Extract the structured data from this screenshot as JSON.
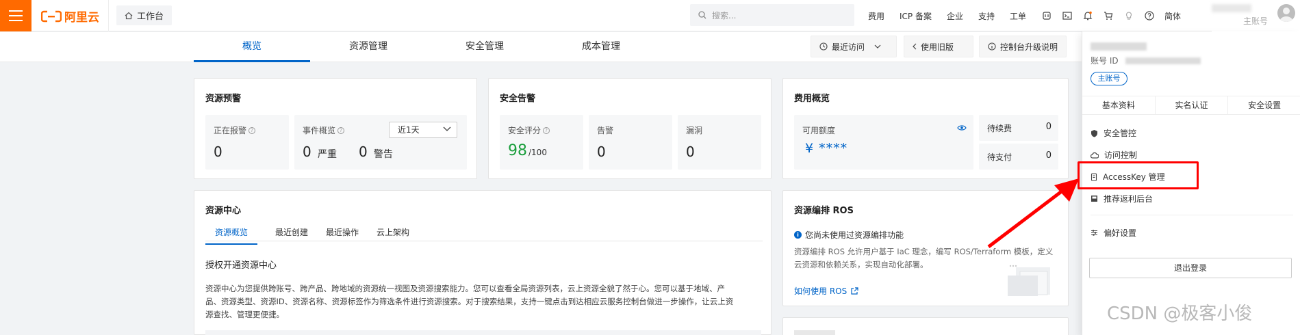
{
  "topbar": {
    "logo_text": "阿里云",
    "workbench_label": "工作台",
    "search_placeholder": "搜索...",
    "links": [
      "费用",
      "ICP 备案",
      "企业",
      "支持",
      "工单"
    ],
    "lang": "简体",
    "account_label": "主账号"
  },
  "nav": {
    "tabs": [
      "概览",
      "资源管理",
      "安全管理",
      "成本管理"
    ],
    "recent": "最近访问",
    "old_version": "使用旧版",
    "upgrade_info": "控制台升级说明"
  },
  "alerts_card": {
    "title": "资源预警",
    "alarming_label": "正在报警",
    "alarming_value": "0",
    "events_label": "事件概览",
    "period": "近1天",
    "serious_value": "0",
    "serious_label": "严重",
    "warning_value": "0",
    "warning_label": "警告"
  },
  "security_card": {
    "title": "安全告警",
    "score_label": "安全评分",
    "score_value": "98",
    "score_total": "/100",
    "alert_label": "告警",
    "alert_value": "0",
    "vuln_label": "漏洞",
    "vuln_value": "0"
  },
  "cost_card": {
    "title": "费用概览",
    "available_label": "可用额度",
    "available_value": "¥ ****",
    "renew_label": "待续费",
    "renew_value": "0",
    "pay_label": "待支付",
    "pay_value": "0"
  },
  "resource_center": {
    "title": "资源中心",
    "tabs": [
      "资源概览",
      "最近创建",
      "最近操作",
      "云上架构"
    ],
    "heading": "授权开通资源中心",
    "description_1": "资源中心为您提供跨账号、跨产品、跨地域的资源统一视图及资源搜索能力。您可以查看全局资源列表，云上资源全貌了然于心。您可以基于地域、产",
    "description_2": "品、资源类型、资源ID、资源名称、资源标签作为筛选条件进行资源搜索。对于搜索结果，支持一键点击到达相应云服务控制台做进一步操作，让云上资",
    "description_3": "源查找、管理更便捷。"
  },
  "ros_card": {
    "title": "资源编排 ROS",
    "notice": "您尚未使用过资源编排功能",
    "desc_1": "资源编排 ROS 允许用户基于 IaC 理念，编写 ROS/Terraform 模板，定义",
    "desc_2": "云资源和依赖关系，实现自动化部署。",
    "link": "如何使用 ROS"
  },
  "account_panel": {
    "id_label": "账号 ID",
    "badge": "主账号",
    "tabs": [
      "基本资料",
      "实名认证",
      "安全设置"
    ],
    "menu": [
      {
        "label": "安全管控",
        "icon": "shield-icon"
      },
      {
        "label": "访问控制",
        "icon": "cloud-icon"
      },
      {
        "label": "AccessKey 管理",
        "icon": "key-icon"
      },
      {
        "label": "推荐返利后台",
        "icon": "book-icon"
      },
      {
        "label": "偏好设置",
        "icon": "sliders-icon"
      }
    ],
    "logout": "退出登录"
  },
  "watermark": "CSDN @极客小俊",
  "colors": {
    "brand": "#ff6a00",
    "primary": "#0064c8",
    "score": "#1a9e3c",
    "highlight": "#ff0000"
  }
}
